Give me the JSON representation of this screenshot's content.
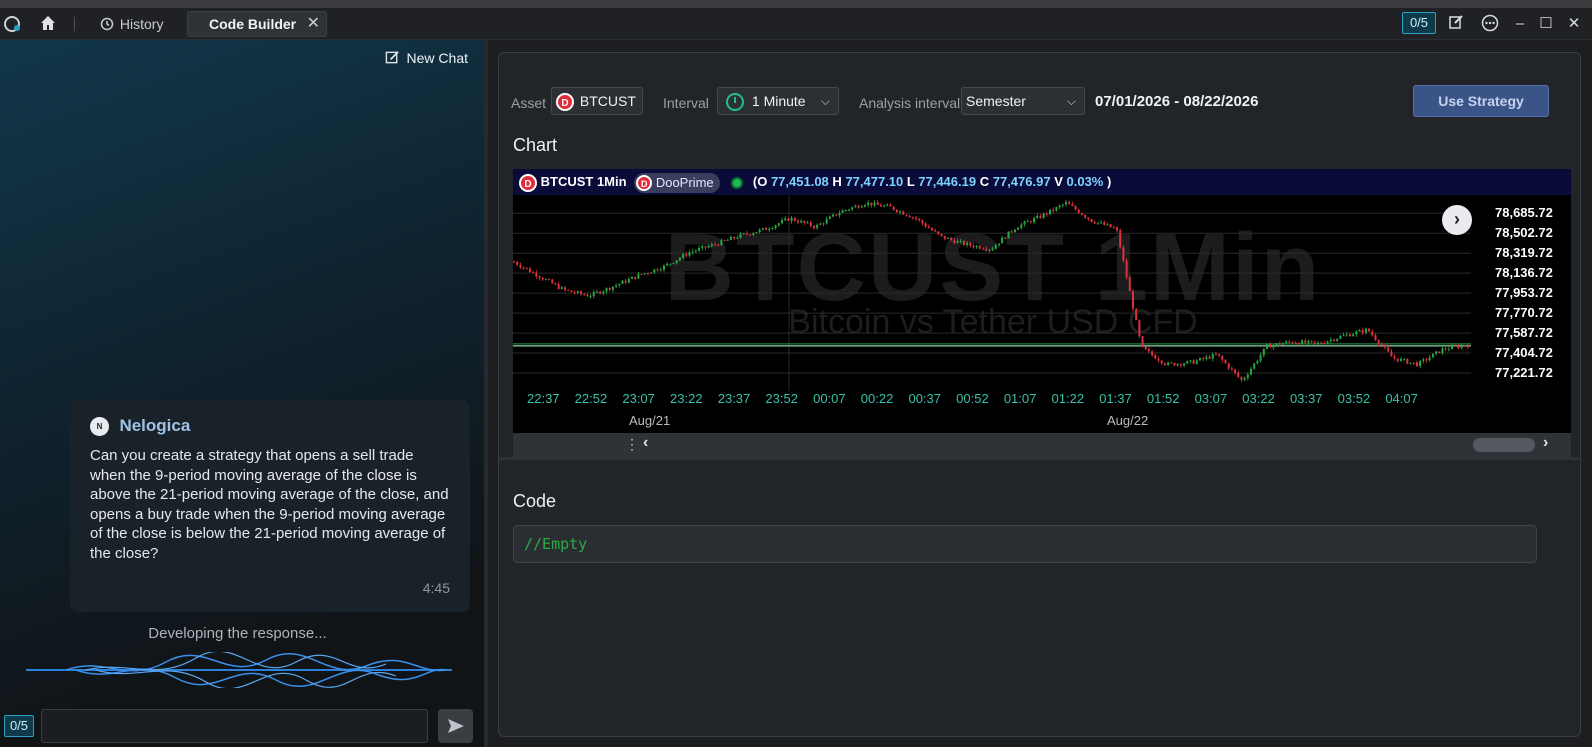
{
  "titlebar": {
    "history_label": "History",
    "active_tab_label": "Code Builder",
    "counter": "0/5",
    "icons": [
      "app-logo-icon",
      "home-icon",
      "history-icon",
      "close-icon",
      "edit-icon",
      "more-icon",
      "minimize-icon",
      "maximize-icon",
      "window-close-icon"
    ]
  },
  "chat": {
    "new_chat_label": "New Chat",
    "message": {
      "avatar_initial": "N",
      "sender": "Nelogica",
      "text": "Can you create a strategy that opens a sell trade when the 9-period moving average of the close is above the 21-period moving average of the close, and opens a buy trade when the 9-period moving average of the close is below the 21-period moving average of the close?",
      "time": "4:45"
    },
    "status": "Developing the response...",
    "input_counter": "0/5",
    "input_value": ""
  },
  "controls": {
    "asset_label": "Asset",
    "asset_value": "BTCUST",
    "interval_label": "Interval",
    "interval_value": "1 Minute",
    "analysis_label": "Analysis interval",
    "analysis_value": "Semester",
    "date_range": "07/01/2026 - 08/22/2026",
    "use_strategy_label": "Use Strategy"
  },
  "chart_section": {
    "title": "Chart",
    "symbol": "BTCUST 1Min",
    "broker": "DooPrime",
    "ohlc": {
      "o_label": "(O",
      "o": "77,451.08",
      "h_label": "H",
      "h": "77,477.10",
      "l_label": "L",
      "l": "77,446.19",
      "c_label": "C",
      "c": "77,476.97",
      "v_label": "V",
      "v": "0.03%",
      "close_paren": ")"
    },
    "watermark_title": "BTCUST 1Min",
    "watermark_subtitle": "Bitcoin vs Tether USD CFD"
  },
  "chart_data": {
    "type": "candlestick",
    "y_ticks": [
      "78,685.72",
      "78,502.72",
      "78,319.72",
      "78,136.72",
      "77,953.72",
      "77,770.72",
      "77,587.72",
      "77,404.72",
      "77,221.72"
    ],
    "x_ticks": [
      "22:37",
      "22:52",
      "23:07",
      "23:22",
      "23:37",
      "23:52",
      "00:07",
      "00:22",
      "00:37",
      "00:52",
      "01:07",
      "01:22",
      "01:37",
      "01:52",
      "03:07",
      "03:22",
      "03:37",
      "03:52",
      "04:07"
    ],
    "x_dates": [
      "Aug/21",
      "Aug/22"
    ],
    "ylim": [
      77130,
      78780
    ],
    "reference_line": 77470,
    "close_path": [
      {
        "t": 0,
        "p": 78240
      },
      {
        "t": 4,
        "p": 78110
      },
      {
        "t": 8,
        "p": 77980
      },
      {
        "t": 12,
        "p": 77930
      },
      {
        "t": 16,
        "p": 78020
      },
      {
        "t": 20,
        "p": 78120
      },
      {
        "t": 24,
        "p": 78200
      },
      {
        "t": 28,
        "p": 78330
      },
      {
        "t": 32,
        "p": 78400
      },
      {
        "t": 36,
        "p": 78480
      },
      {
        "t": 40,
        "p": 78540
      },
      {
        "t": 44,
        "p": 78640
      },
      {
        "t": 48,
        "p": 78560
      },
      {
        "t": 52,
        "p": 78700
      },
      {
        "t": 56,
        "p": 78780
      },
      {
        "t": 60,
        "p": 78740
      },
      {
        "t": 64,
        "p": 78640
      },
      {
        "t": 68,
        "p": 78470
      },
      {
        "t": 72,
        "p": 78400
      },
      {
        "t": 76,
        "p": 78360
      },
      {
        "t": 80,
        "p": 78560
      },
      {
        "t": 84,
        "p": 78660
      },
      {
        "t": 88,
        "p": 78780
      },
      {
        "t": 92,
        "p": 78620
      },
      {
        "t": 96,
        "p": 78540
      },
      {
        "t": 100,
        "p": 77450
      },
      {
        "t": 104,
        "p": 77300
      },
      {
        "t": 108,
        "p": 77320
      },
      {
        "t": 112,
        "p": 77390
      },
      {
        "t": 116,
        "p": 77150
      },
      {
        "t": 120,
        "p": 77470
      },
      {
        "t": 124,
        "p": 77510
      },
      {
        "t": 128,
        "p": 77490
      },
      {
        "t": 132,
        "p": 77560
      },
      {
        "t": 136,
        "p": 77620
      },
      {
        "t": 140,
        "p": 77360
      },
      {
        "t": 144,
        "p": 77300
      },
      {
        "t": 148,
        "p": 77440
      },
      {
        "t": 152,
        "p": 77480
      }
    ]
  },
  "code_section": {
    "title": "Code",
    "content": "//Empty"
  }
}
